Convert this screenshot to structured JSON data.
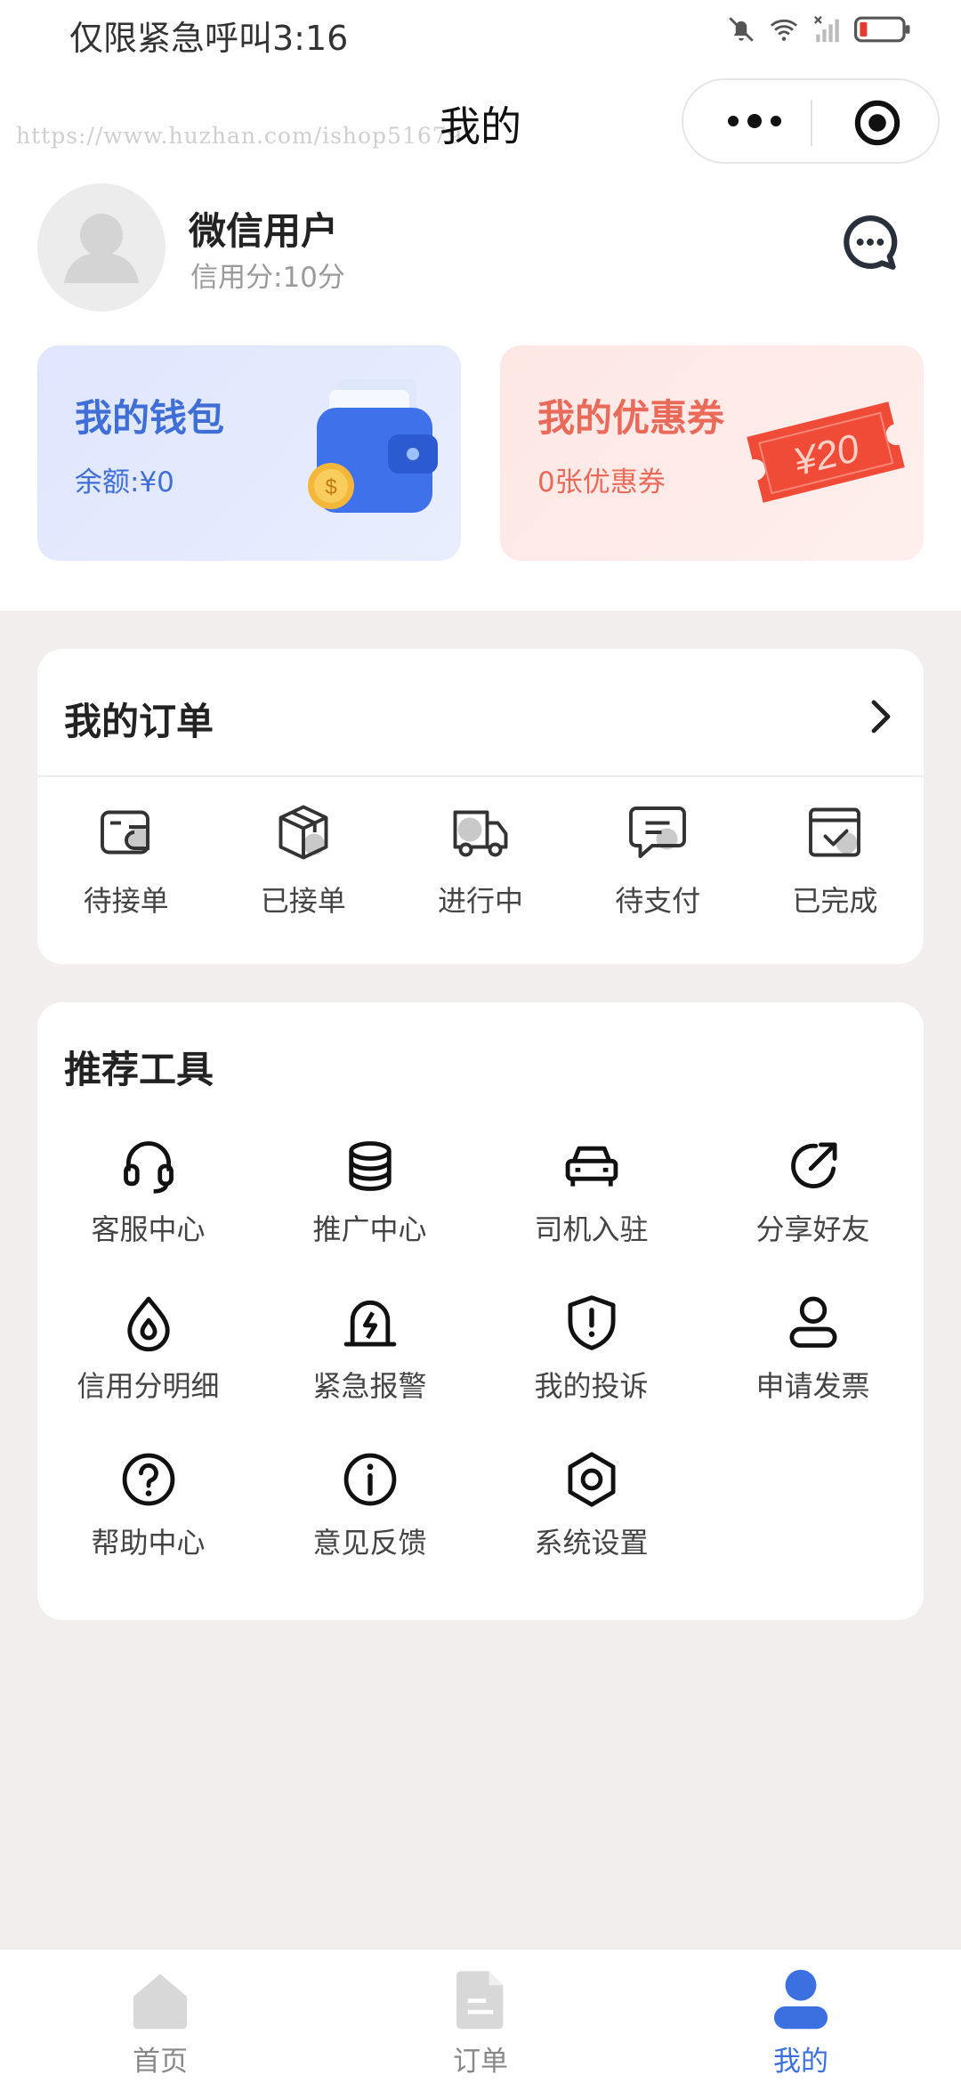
{
  "status_bar": {
    "time": "仅限紧急呼叫3:16"
  },
  "nav": {
    "title": "我的",
    "watermark": "https://www.huzhan.com/ishop51679"
  },
  "profile": {
    "name": "微信用户",
    "credit": "信用分:10分"
  },
  "wallet": {
    "title": "我的钱包",
    "balance": "余额:¥0"
  },
  "coupon": {
    "title": "我的优惠券",
    "count": "0张优惠券",
    "ticket_text": "¥20"
  },
  "orders": {
    "title": "我的订单",
    "items": [
      {
        "label": "待接单",
        "icon": "wallet-icon"
      },
      {
        "label": "已接单",
        "icon": "package-icon"
      },
      {
        "label": "进行中",
        "icon": "truck-icon"
      },
      {
        "label": "待支付",
        "icon": "message-card-icon"
      },
      {
        "label": "已完成",
        "icon": "checked-box-icon"
      }
    ]
  },
  "tools": {
    "title": "推荐工具",
    "items": [
      {
        "label": "客服中心",
        "icon": "headset-icon"
      },
      {
        "label": "推广中心",
        "icon": "coins-icon"
      },
      {
        "label": "司机入驻",
        "icon": "car-icon"
      },
      {
        "label": "分享好友",
        "icon": "share-icon"
      },
      {
        "label": "信用分明细",
        "icon": "drop-icon"
      },
      {
        "label": "紧急报警",
        "icon": "alarm-icon"
      },
      {
        "label": "我的投诉",
        "icon": "shield-alert-icon"
      },
      {
        "label": "申请发票",
        "icon": "user-icon"
      },
      {
        "label": "帮助中心",
        "icon": "help-icon"
      },
      {
        "label": "意见反馈",
        "icon": "info-icon"
      },
      {
        "label": "系统设置",
        "icon": "settings-icon"
      }
    ]
  },
  "tabbar": {
    "items": [
      {
        "label": "首页",
        "icon": "home-icon"
      },
      {
        "label": "订单",
        "icon": "document-icon"
      },
      {
        "label": "我的",
        "icon": "person-icon"
      }
    ],
    "active_index": 2
  },
  "colors": {
    "accent": "#3c70e0",
    "wallet_text": "#3f6fd6",
    "coupon_text": "#ea6a5a",
    "page_bg": "#f1eeed"
  }
}
